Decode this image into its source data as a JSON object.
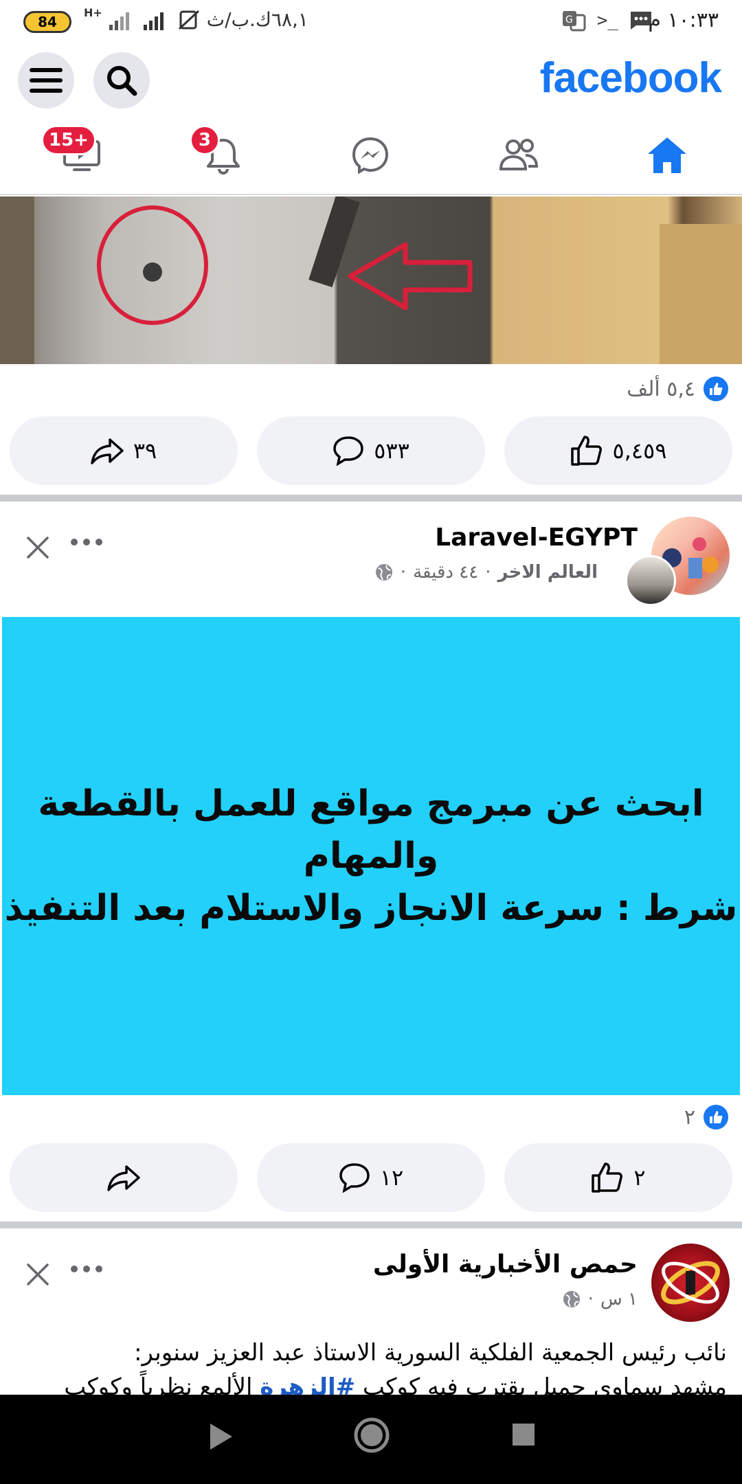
{
  "status_bar": {
    "time": "١٠:٣٣ م",
    "battery": "84",
    "net_speed": "٦٨,١ك.ب/ث",
    "network_type": "H+"
  },
  "header": {
    "logo": "facebook",
    "icons": [
      "menu-icon",
      "search-icon"
    ]
  },
  "tabs": {
    "items": [
      {
        "name": "home",
        "icon": "home-icon",
        "active": true
      },
      {
        "name": "friends",
        "icon": "friends-icon"
      },
      {
        "name": "messenger",
        "icon": "messenger-icon"
      },
      {
        "name": "notifications",
        "icon": "bell-icon",
        "badge": "3"
      },
      {
        "name": "watch",
        "icon": "video-icon",
        "badge": "15+"
      }
    ],
    "notifications_badge": "3",
    "watch_badge": "15+"
  },
  "post1": {
    "reactions_count": "٥,٤ ألف",
    "like_count": "٥,٤٥٩",
    "comment_count": "٥٣٣",
    "share_count": "٣٩"
  },
  "post2": {
    "page_name": "Laravel-EGYPT",
    "group": "العالم الاخر",
    "time": "٤٤ دقيقة",
    "text_line1": "ابحث عن مبرمج مواقع للعمل بالقطعة",
    "text_line2": "والمهام",
    "text_line3": "شرط : سرعة الانجاز والاستلام بعد التنفيذ",
    "background": "#22d0fa",
    "reactions_count": "٢",
    "like_count": "٢",
    "comment_count": "١٢"
  },
  "post3": {
    "page_name": "حمص الأخبارية الأولى",
    "time": "١ س",
    "text_line1": "نائب رئيس الجمعية الفلكية السورية الاستاذ عبد العزيز سنوبر:",
    "text_line2_start": "مشهد سماوي جميل يقترب فيه كوكب ",
    "hashtag": "#الزهرة",
    "text_line2_end": " الألمع نظرياً وكوكب"
  },
  "colors": {
    "brand": "#1877f2",
    "badge": "#e41e3f",
    "button_bg": "#f0f2f5"
  }
}
